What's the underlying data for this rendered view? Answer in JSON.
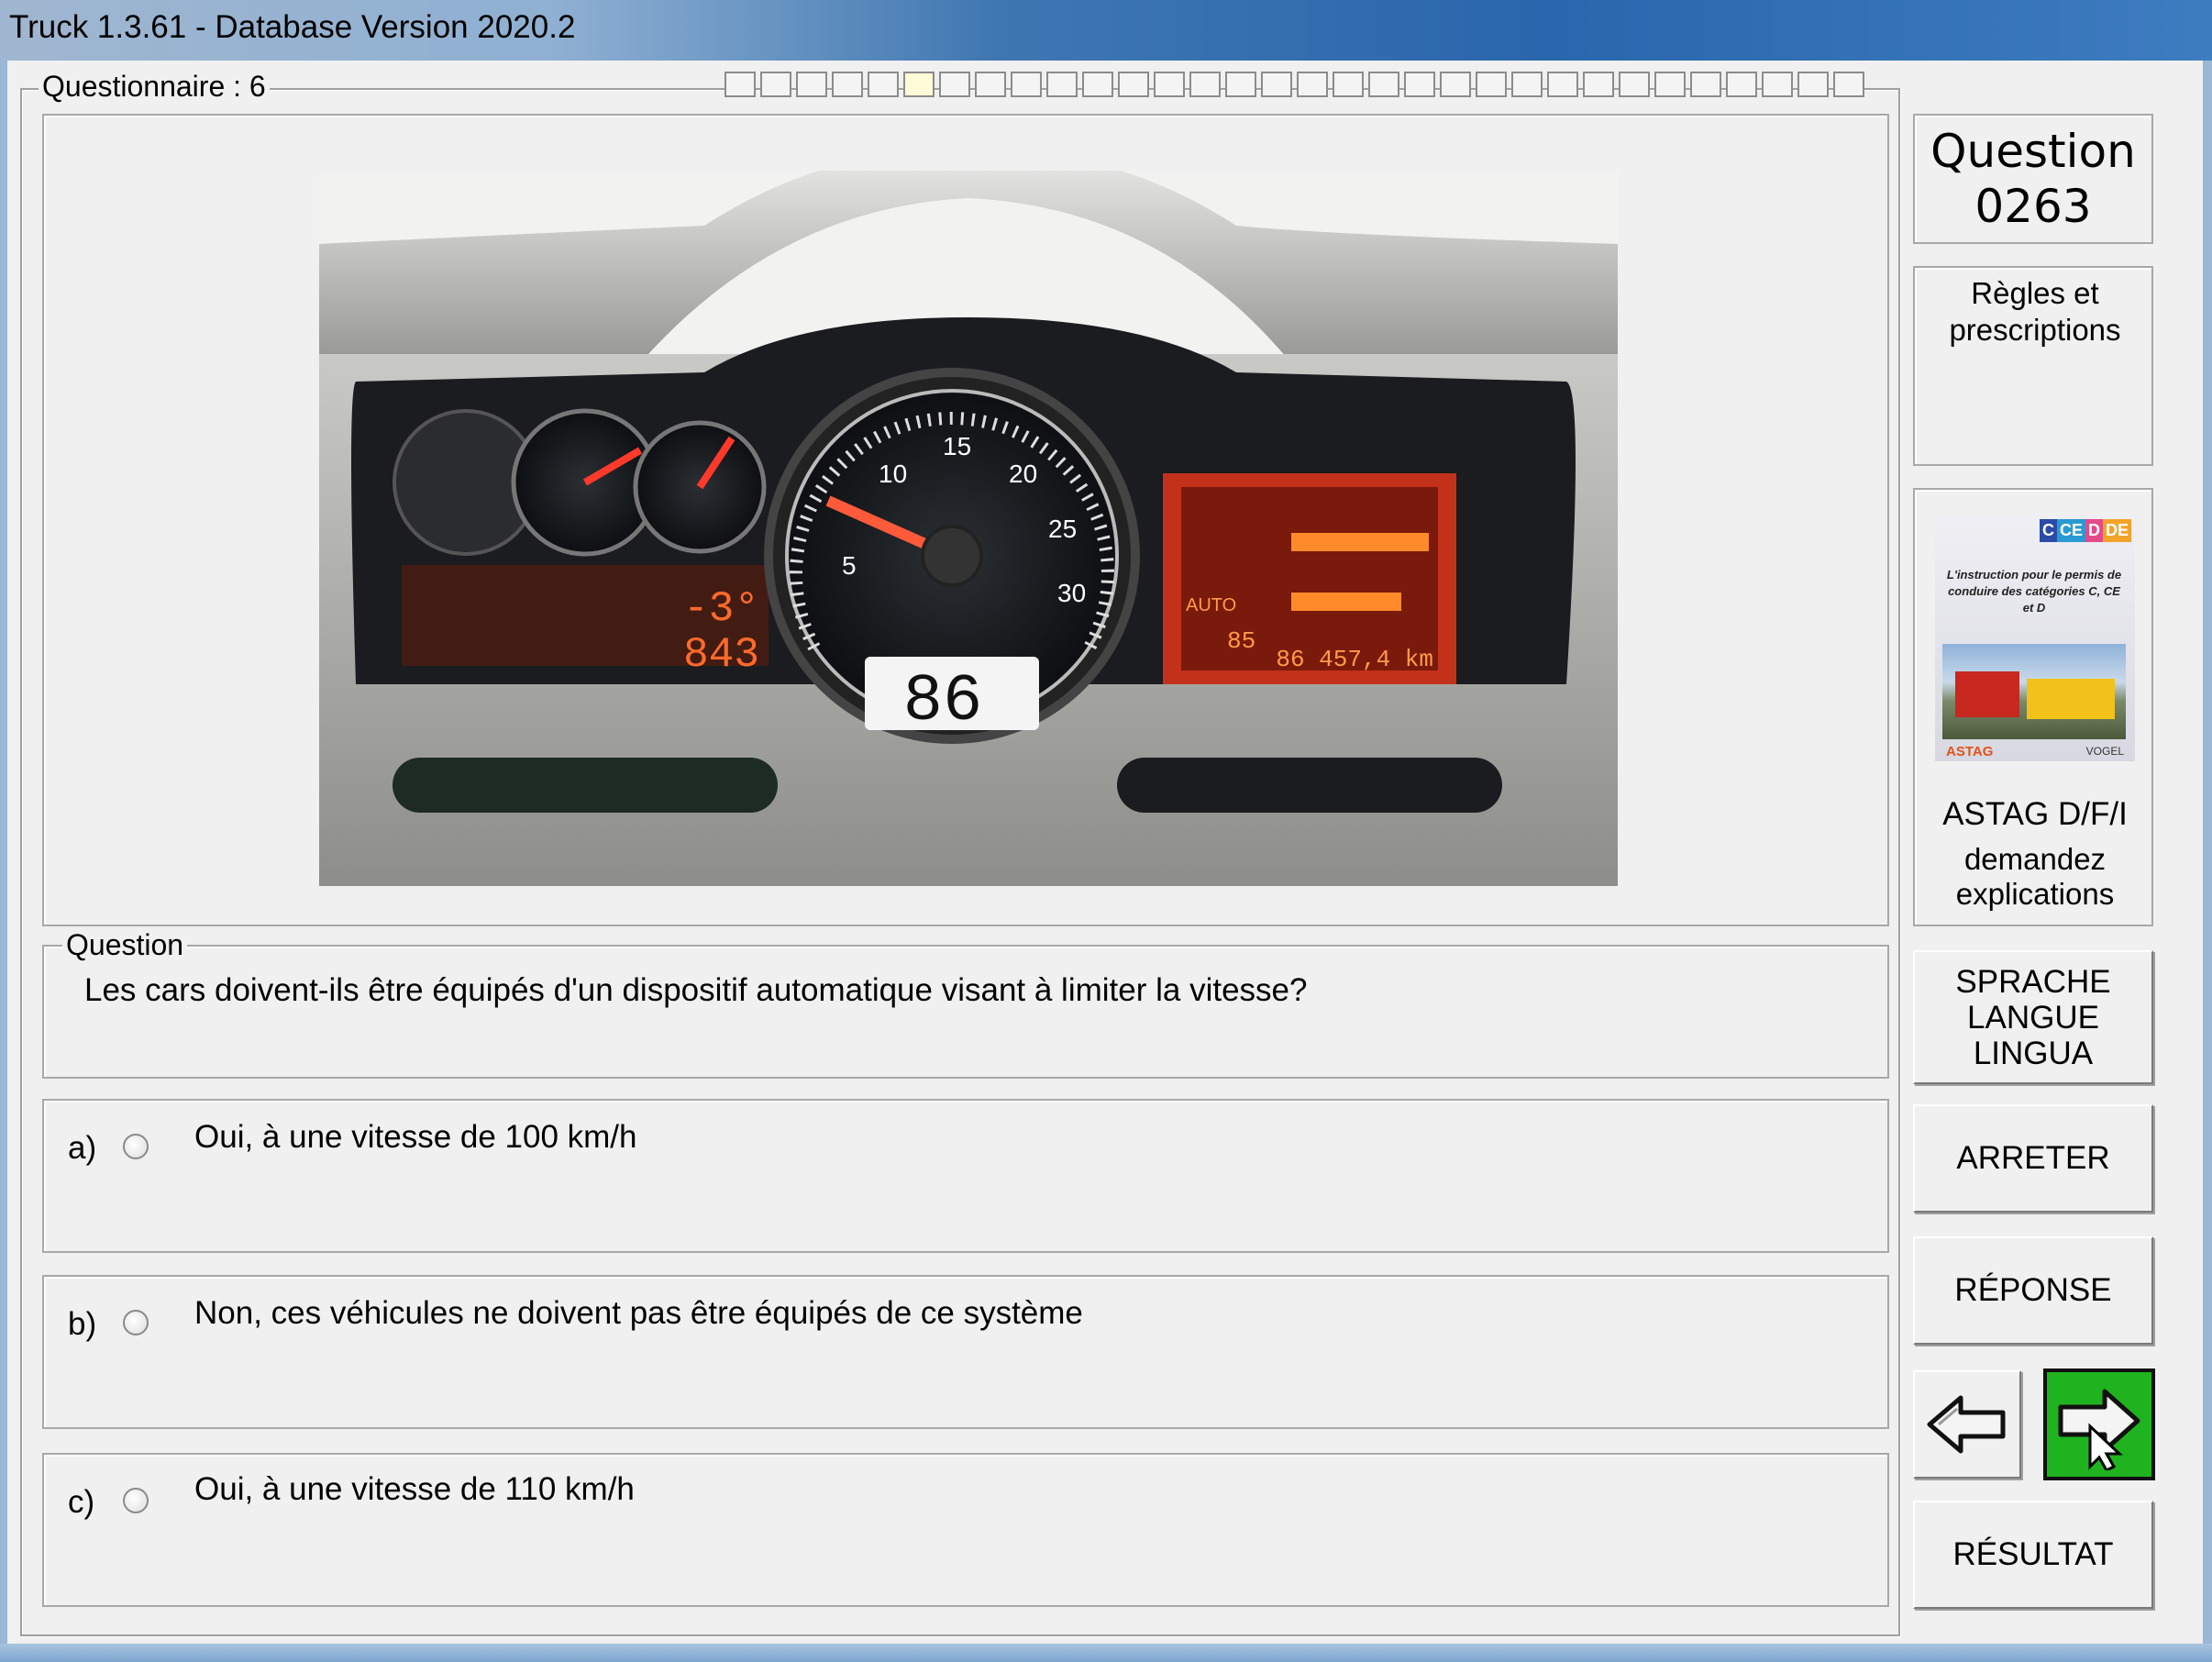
{
  "window": {
    "title": "Truck 1.3.61 - Database Version 2020.2"
  },
  "questionnaire": {
    "label": "Questionnaire : 6",
    "cells": 32,
    "current_cell": 5
  },
  "question": {
    "legend": "Question",
    "text": "Les cars doivent-ils être équipés d'un dispositif automatique visant à limiter la vitesse?"
  },
  "answers": [
    {
      "letter": "a)",
      "text": "Oui,  à une vitesse de 100 km/h"
    },
    {
      "letter": "b)",
      "text": "Non, ces véhicules ne doivent pas être équipés de ce système"
    },
    {
      "letter": "c)",
      "text": "Oui, à une vitesse de 110 km/h"
    }
  ],
  "sidebar": {
    "question_label": "Question",
    "question_number": "0263",
    "category": "Règles et prescriptions",
    "book": {
      "badges": [
        "C",
        "CE",
        "D",
        "DE"
      ],
      "cover_text": "L'instruction pour le permis de conduire des catégories C, CE et D",
      "publisher_left": "ASTAG",
      "publisher_right": "VOGEL",
      "caption_line1": "ASTAG D/F/I",
      "caption_line2": "demandez",
      "caption_line3": "explications"
    },
    "language_button": [
      "SPRACHE",
      "LANGUE",
      "LINGUA"
    ],
    "stop_button": "ARRETER",
    "answer_button": "RÉPONSE",
    "result_button": "RÉSULTAT"
  },
  "dashboard": {
    "speed_display": "86",
    "temperature": "-3°",
    "counter": "843",
    "odometer": "86 457,4 km",
    "mode": "AUTO",
    "limit": "85"
  },
  "colors": {
    "next_button": "#1fb31f",
    "title_gradient": "#2a66ad"
  }
}
